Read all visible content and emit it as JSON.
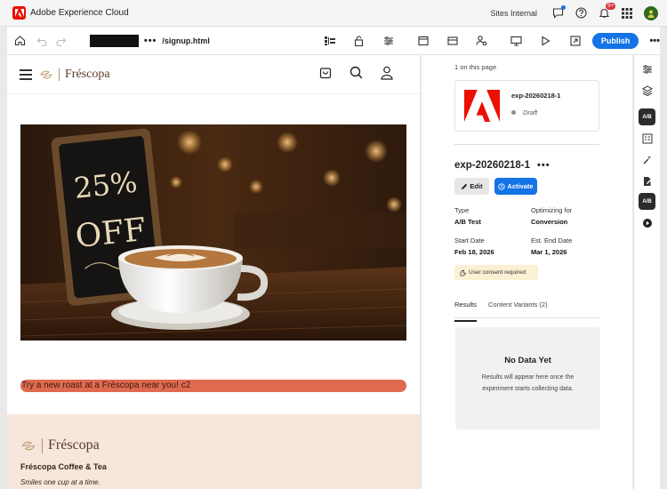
{
  "app": {
    "title": "Adobe Experience Cloud",
    "org": "Sites Internal",
    "notification_count": "9+"
  },
  "toolbar": {
    "url_path": "/signup.html",
    "more_dots": "•••",
    "publish_label": "Publish"
  },
  "site": {
    "brand_name": "Fréscopa",
    "promo_text": "Try a new roast at a Fréscopa near you! c2",
    "footer_brand": "Fréscopa",
    "footer_title": "Fréscopa Coffee & Tea",
    "footer_tagline": "Smiles one cup at a time.",
    "sign_line1": "25%",
    "sign_line2": "OFF"
  },
  "panel": {
    "count_label": "1 on this page",
    "card": {
      "name": "exp-20260218-1",
      "status": "Draft"
    },
    "experiment_name": "exp-20260218-1",
    "edit_label": "Edit",
    "activate_label": "Activate",
    "details": {
      "type_label": "Type",
      "type_value": "A/B Test",
      "optimizing_label": "Optimizing for",
      "optimizing_value": "Conversion",
      "start_label": "Start Date",
      "start_value": "Feb 18, 2026",
      "end_label": "Est. End Date",
      "end_value": "Mar 1, 2026"
    },
    "consent_label": "User consent required",
    "tabs": [
      "Results",
      "Content Variants (2)"
    ],
    "nodata_title": "No Data Yet",
    "nodata_text": "Results will appear here once the experiment starts collecting data."
  },
  "rail": {
    "ab_label": "A/B"
  },
  "colors": {
    "accent": "#1473e6",
    "adobe_red": "#eb1000",
    "promo": "#e06a4f",
    "footer_bg": "#f6e6dc"
  }
}
